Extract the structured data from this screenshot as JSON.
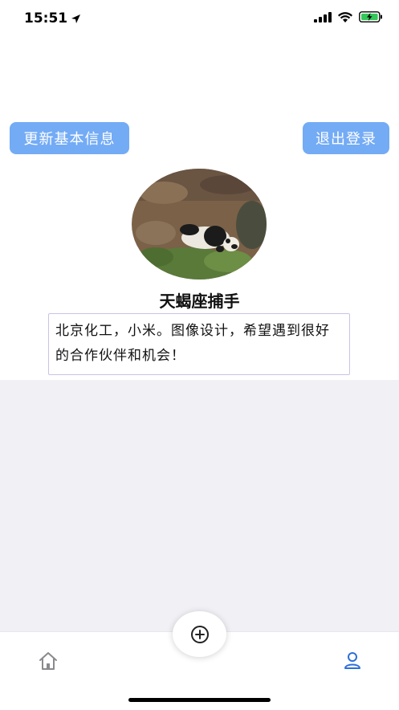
{
  "status_bar": {
    "time": "15:51"
  },
  "profile": {
    "update_button_label": "更新基本信息",
    "logout_button_label": "退出登录",
    "username": "天蝎座捕手",
    "bio": "北京化工，小米。图像设计，希望遇到很好的合作伙伴和机会！"
  },
  "tab_bar": {
    "items": [
      {
        "icon": "home-icon"
      },
      {
        "icon": "add-circle-icon"
      },
      {
        "icon": "person-icon"
      }
    ],
    "active_color": "#2e6fd8",
    "inactive_color": "#8a8a8e"
  },
  "colors": {
    "button_bg": "#73abf5",
    "page_bg": "#f1f0f5"
  }
}
